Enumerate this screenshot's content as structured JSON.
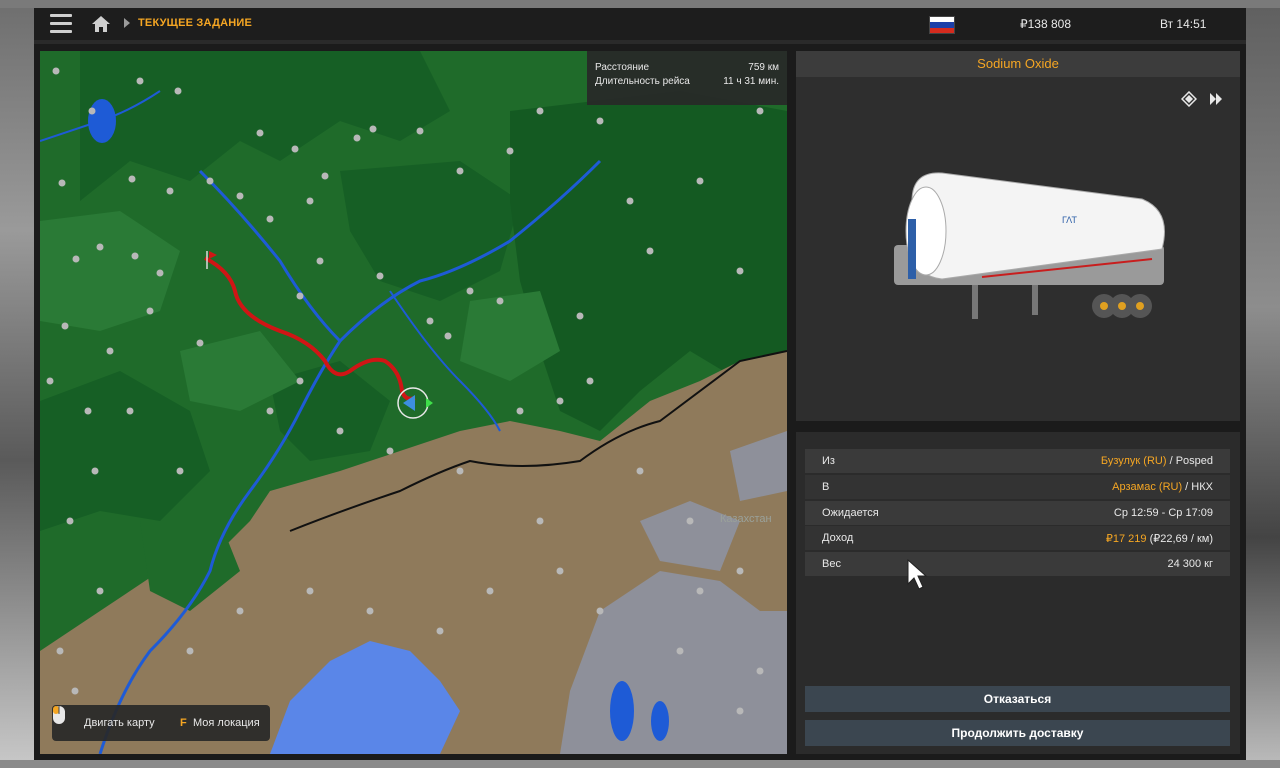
{
  "topbar": {
    "breadcrumb": "ТЕКУЩЕЕ ЗАДАНИЕ",
    "money": "₽138 808",
    "time": "Вт 14:51",
    "flag_colors": [
      "#ffffff",
      "#1c3fa8",
      "#d52b1e"
    ]
  },
  "icons": {
    "menu": "menu-icon",
    "home": "home-icon",
    "mouse": "mouse-icon",
    "cursor": "cursor-icon",
    "cargo_info": "hazard-diamond-icon",
    "cargo_next": "skip-forward-icon"
  },
  "map": {
    "info": {
      "distance_label": "Расстояние",
      "distance_value": "759 км",
      "duration_label": "Длительность рейса",
      "duration_value": "11 ч 31 мин."
    },
    "country_label": "Казахстан",
    "legend": {
      "move_label": "Двигать карту",
      "location_key": "F",
      "location_label": "Моя локация"
    },
    "colors": {
      "land": "#1f6b2a",
      "forest": "#145a22",
      "steppe": "#8f7a5b",
      "water": "#1e5bd6",
      "sea": "#5a86e8",
      "route": "#d01515",
      "snow": "#8e909a"
    }
  },
  "cargo": {
    "title": "Sodium Oxide"
  },
  "details": {
    "rows": [
      {
        "label": "Из",
        "city": "Бузулук (RU)",
        "sep": " / ",
        "company": "Posped"
      },
      {
        "label": "В",
        "city": "Арзамас (RU)",
        "sep": " / ",
        "company": "НКХ"
      },
      {
        "label": "Ожидается",
        "value": "Ср 12:59 - Ср 17:09"
      },
      {
        "label": "Доход",
        "value": "₽17 219",
        "extra": " (₽22,69 / км)"
      },
      {
        "label": "Вес",
        "value": "24 300 кг"
      }
    ],
    "decline_button": "Отказаться",
    "continue_button": "Продолжить доставку"
  }
}
